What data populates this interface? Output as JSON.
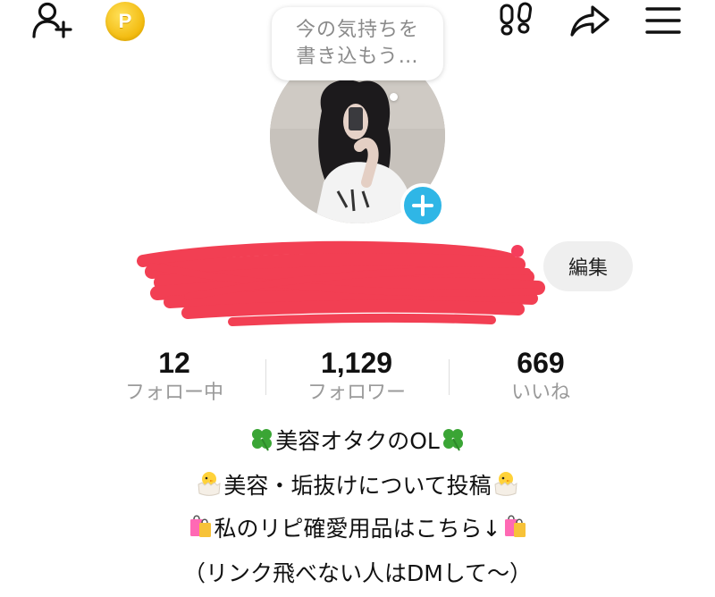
{
  "header": {
    "points_badge": "P"
  },
  "bubble": {
    "line1": "今の気持ちを",
    "line2": "書き込もう…"
  },
  "profile": {
    "edit_label": "編集"
  },
  "stats": [
    {
      "value": "12",
      "label": "フォロー中"
    },
    {
      "value": "1,129",
      "label": "フォロワー"
    },
    {
      "value": "669",
      "label": "いいね"
    }
  ],
  "bio": {
    "line1": "美容オタクのOL",
    "line2": "美容・垢抜けについて投稿",
    "line3": "私のリピ確愛用品はこちら↓",
    "line4": "（リンク飛べない人はDMして〜）"
  },
  "colors": {
    "accent_blue": "#2fb6e6",
    "notify_red": "#f53d5c",
    "redaction_red": "#f2354a",
    "coin_gold": "#f2b90c"
  }
}
